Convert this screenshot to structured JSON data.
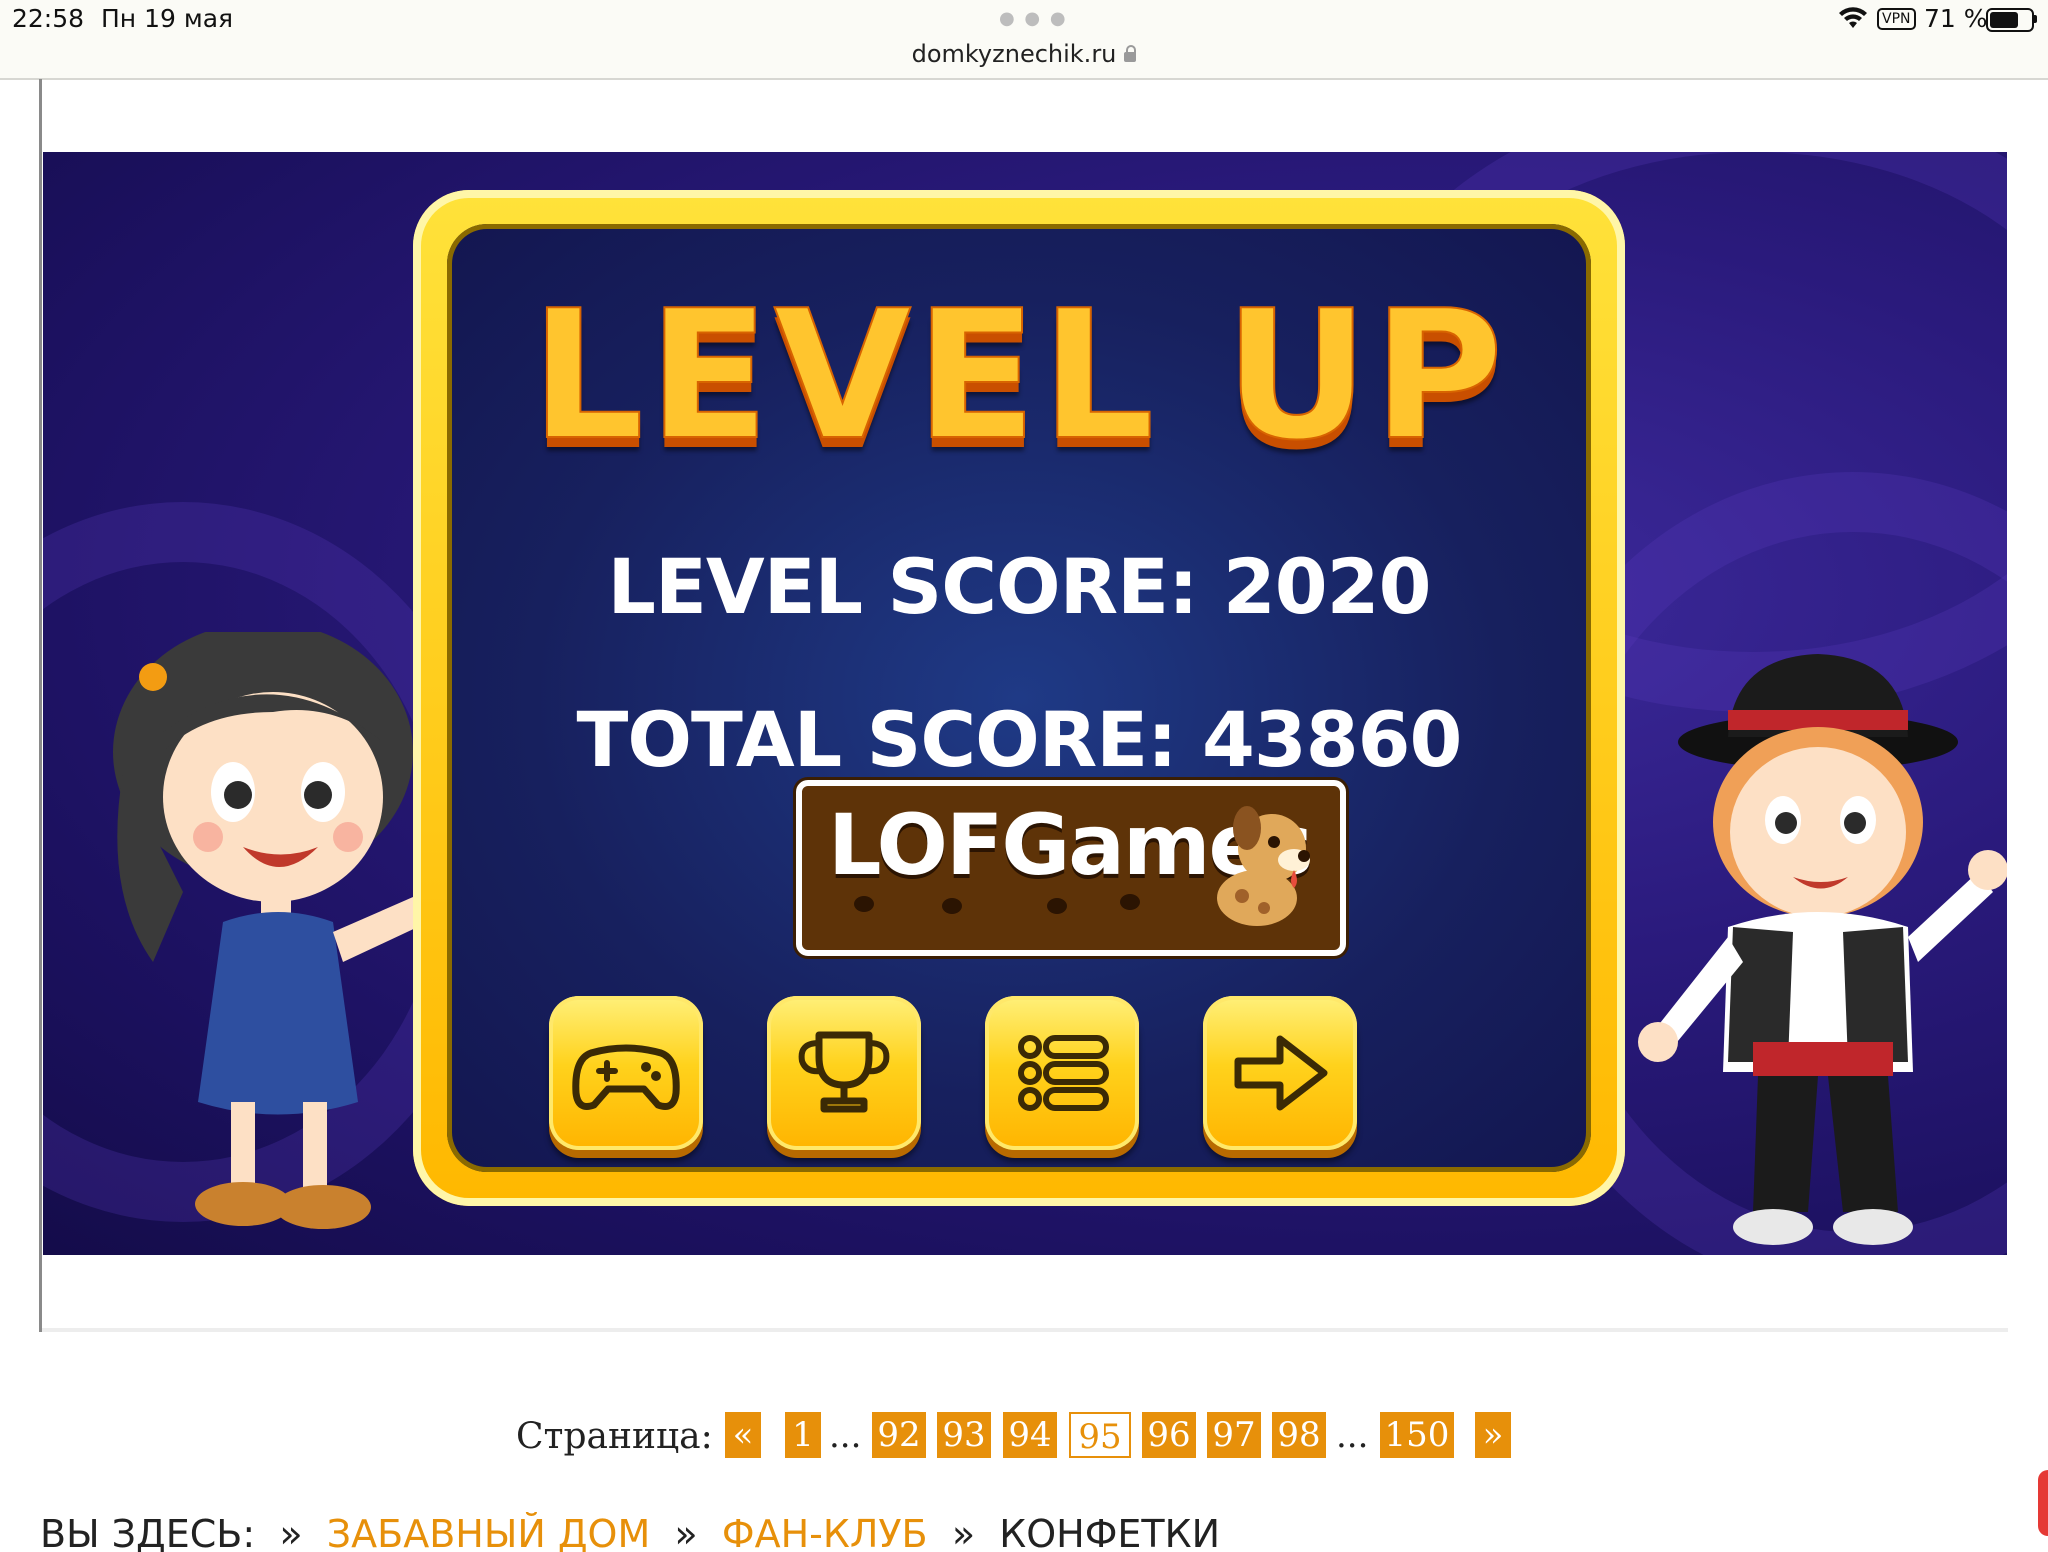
{
  "status_bar": {
    "time": "22:58",
    "date": "Пн 19 мая",
    "url": "domkyznechik.ru",
    "vpn": "VPN",
    "battery_text": "71 %",
    "battery_level": 0.71
  },
  "game": {
    "title": "LEVEL UP",
    "level_score": "LEVEL SCORE: 2020",
    "total_score": "TOTAL SCORE: 43860",
    "logo_text": "LOFGames",
    "buttons": [
      "gamepad-icon",
      "trophy-icon",
      "list-icon",
      "arrow-right-icon"
    ]
  },
  "pagination": {
    "label": "Страница:",
    "prev": "«",
    "next": "»",
    "ellipsis": "...",
    "pages": [
      "1",
      "92",
      "93",
      "94",
      "95",
      "96",
      "97",
      "98",
      "150"
    ],
    "current": "95"
  },
  "breadcrumb": {
    "prefix": "ВЫ ЗДЕСЬ:",
    "links": [
      "ЗАБАВНЫЙ ДОМ",
      "ФАН-КЛУБ"
    ],
    "current": "КОНФЕТКИ"
  },
  "colors": {
    "accent": "#e7900a",
    "game_gold": "#ffc52e",
    "game_bg": "#1c1160"
  }
}
